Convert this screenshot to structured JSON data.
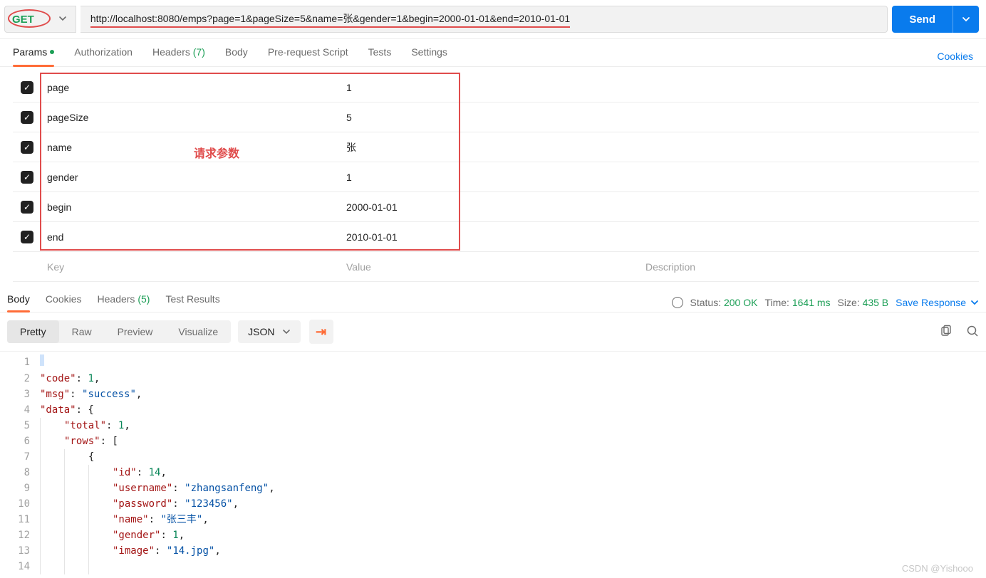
{
  "method": "GET",
  "url": "http://localhost:8080/emps?page=1&pageSize=5&name=张&gender=1&begin=2000-01-01&end=2010-01-01",
  "send_label": "Send",
  "annotation": "请求参数",
  "tabs": {
    "params": "Params",
    "authorization": "Authorization",
    "headers": "Headers",
    "headers_count": "(7)",
    "body": "Body",
    "prerequest": "Pre-request Script",
    "tests": "Tests",
    "settings": "Settings",
    "cookies": "Cookies"
  },
  "params": [
    {
      "key": "page",
      "value": "1"
    },
    {
      "key": "pageSize",
      "value": "5"
    },
    {
      "key": "name",
      "value": "张"
    },
    {
      "key": "gender",
      "value": "1"
    },
    {
      "key": "begin",
      "value": "2000-01-01"
    },
    {
      "key": "end",
      "value": "2010-01-01"
    }
  ],
  "placeholders": {
    "key": "Key",
    "value": "Value",
    "description": "Description"
  },
  "response_tabs": {
    "body": "Body",
    "cookies": "Cookies",
    "headers": "Headers",
    "headers_count": "(5)",
    "test_results": "Test Results"
  },
  "status": {
    "label": "Status:",
    "value": "200 OK"
  },
  "time": {
    "label": "Time:",
    "value": "1641 ms"
  },
  "size": {
    "label": "Size:",
    "value": "435 B"
  },
  "save_response": "Save Response",
  "view_modes": {
    "pretty": "Pretty",
    "raw": "Raw",
    "preview": "Preview",
    "visualize": "Visualize"
  },
  "format": "JSON",
  "json": {
    "code": 1,
    "msg": "success",
    "data": {
      "total": 1,
      "rows": [
        {
          "id": 14,
          "username": "zhangsanfeng",
          "password": "123456",
          "name": "张三丰",
          "gender": 1,
          "image": "14.jpg"
        }
      ]
    }
  },
  "watermark": "CSDN @Yishooo"
}
